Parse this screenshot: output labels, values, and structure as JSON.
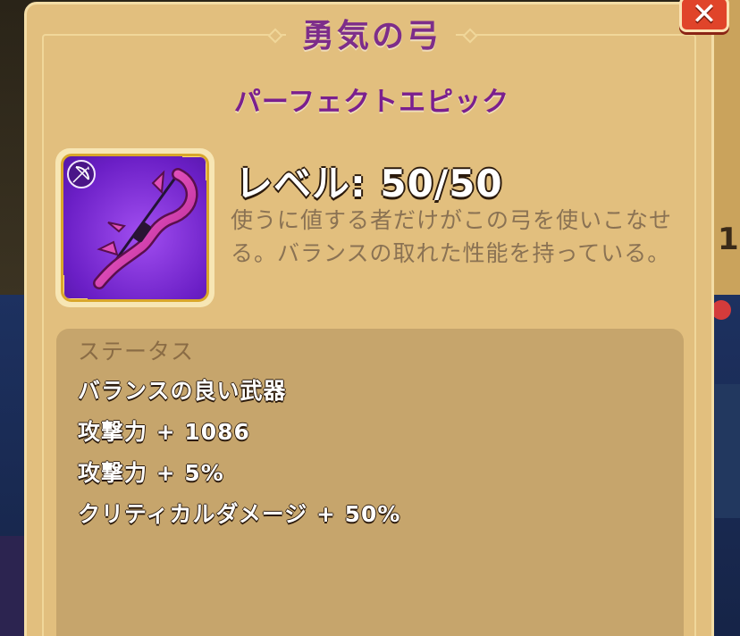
{
  "item": {
    "name": "勇気の弓",
    "rarity": "パーフェクトエピック",
    "level": "レベル: 50/50",
    "description": "使うに値する者だけがこの弓を使いこなせる。バランスの取れた性能を持っている。",
    "icon": "bow-icon",
    "type_badge_icon": "bow-class-icon"
  },
  "close_button": {
    "icon": "close-icon",
    "glyph": "✕"
  },
  "stats": {
    "title": "ステータス",
    "lines": [
      "バランスの良い武器",
      "攻撃力 + 1086",
      "攻撃力 + 5%",
      "クリティカルダメージ + 50%"
    ]
  },
  "background": {
    "right_number": "1"
  },
  "colors": {
    "popup_bg": "#e2bf7e",
    "title_purple": "#7d2d8a",
    "epic_purple": "#8a3ae6",
    "stats_panel": "#c6a56c",
    "close_red": "#e0442a"
  }
}
